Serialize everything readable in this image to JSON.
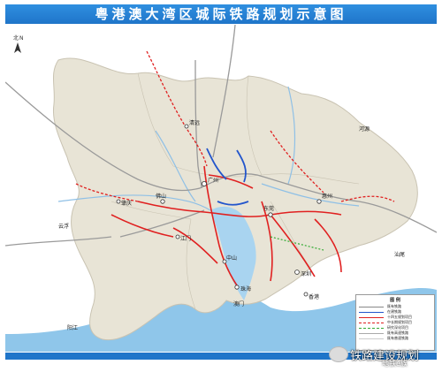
{
  "title": "粤港澳大湾区城际铁路规划示意图",
  "north": {
    "label": "北",
    "letter": "N"
  },
  "cities": {
    "guangzhou": "广州",
    "foshan": "佛山",
    "dongguan": "东莞",
    "huizhou": "惠州",
    "shenzhen": "深圳",
    "zhuhai": "珠海",
    "zhongshan": "中山",
    "jiangmen": "江门",
    "zhaoqing": "肇庆",
    "qingyuan": "清远",
    "aomen": "澳门",
    "xianggang": "香港",
    "heyuan": "河源",
    "yunfu": "云浮",
    "shanwei": "汕尾",
    "yangjiang": "阳江"
  },
  "legend": {
    "title": "图 例",
    "items": [
      {
        "label": "既有铁路",
        "color": "#888888",
        "style": "solid"
      },
      {
        "label": "在建铁路",
        "color": "#2255cc",
        "style": "solid"
      },
      {
        "label": "十四五规划项目",
        "color": "#e02020",
        "style": "solid"
      },
      {
        "label": "中长期规划项目",
        "color": "#e02020",
        "style": "dashed"
      },
      {
        "label": "研究深化项目",
        "color": "#33aa33",
        "style": "dashed"
      },
      {
        "label": "既有高速铁路",
        "color": "#aaaaaa",
        "style": "solid"
      },
      {
        "label": "既有普速铁路",
        "color": "#cccccc",
        "style": "solid"
      }
    ]
  },
  "watermark": {
    "text": "铁路建设规划",
    "sub": "地铁e族"
  },
  "colors": {
    "land": "#f2efe6",
    "region": "#e6e2d6",
    "water": "#a9d4f0",
    "sea": "#8fc6ea",
    "rail_existing": "#9a9a9a",
    "rail_plan": "#e02020",
    "rail_build": "#2255cc"
  }
}
